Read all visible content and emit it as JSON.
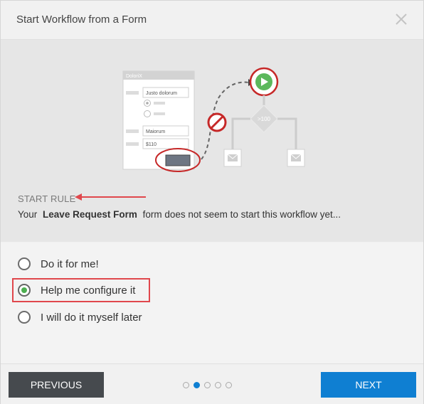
{
  "dialog": {
    "title": "Start Workflow from a Form"
  },
  "illustration": {
    "form_title": "DoloriX",
    "field_values": [
      "Justo dolorum",
      "Maiorum",
      "$110"
    ],
    "condition_label": ">100"
  },
  "rule": {
    "heading": "START RULE",
    "desc_prefix": "Your",
    "form_name": "Leave Request Form",
    "desc_suffix": "form does not seem to start this workflow yet..."
  },
  "options": [
    {
      "label": "Do it for me!",
      "checked": false
    },
    {
      "label": "Help me configure it",
      "checked": true
    },
    {
      "label": "I will do it myself later",
      "checked": false
    }
  ],
  "footer": {
    "previous_label": "PREVIOUS",
    "next_label": "NEXT",
    "pagination": {
      "total": 5,
      "current": 2
    }
  },
  "colors": {
    "accent": "#0f7fd2",
    "danger": "#e0474c",
    "success": "#4caf50",
    "dark_button": "#464a4e"
  }
}
